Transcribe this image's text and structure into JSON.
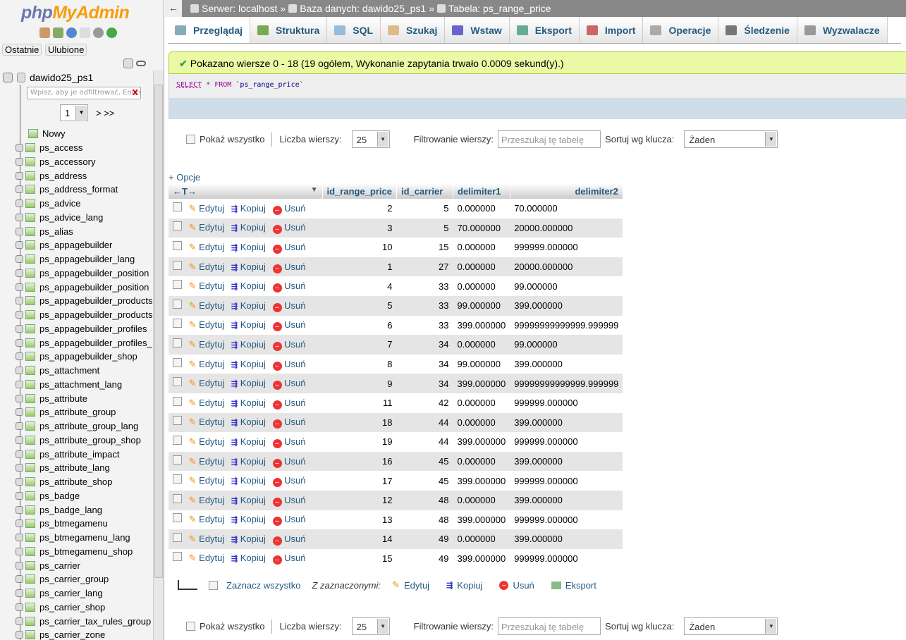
{
  "sidebar": {
    "logo_php": "php",
    "logo_my": "MyAdmin",
    "recent": "Ostatnie",
    "favorites": "Ulubione",
    "database": "dawido25_ps1",
    "filter_placeholder": "Wpisz, aby je odfiltrować, Enter, a",
    "filter_clear": "X",
    "page": "1",
    "page_next": "> >>",
    "new_label": "Nowy",
    "tables": [
      "ps_access",
      "ps_accessory",
      "ps_address",
      "ps_address_format",
      "ps_advice",
      "ps_advice_lang",
      "ps_alias",
      "ps_appagebuilder",
      "ps_appagebuilder_lang",
      "ps_appagebuilder_position",
      "ps_appagebuilder_position",
      "ps_appagebuilder_products",
      "ps_appagebuilder_products",
      "ps_appagebuilder_profiles",
      "ps_appagebuilder_profiles_",
      "ps_appagebuilder_shop",
      "ps_attachment",
      "ps_attachment_lang",
      "ps_attribute",
      "ps_attribute_group",
      "ps_attribute_group_lang",
      "ps_attribute_group_shop",
      "ps_attribute_impact",
      "ps_attribute_lang",
      "ps_attribute_shop",
      "ps_badge",
      "ps_badge_lang",
      "ps_btmegamenu",
      "ps_btmegamenu_lang",
      "ps_btmegamenu_shop",
      "ps_carrier",
      "ps_carrier_group",
      "ps_carrier_lang",
      "ps_carrier_shop",
      "ps_carrier_tax_rules_group",
      "ps_carrier_zone"
    ]
  },
  "breadcrumb": {
    "back": "←",
    "server": "Serwer: localhost",
    "sep": "»",
    "database": "Baza danych: dawido25_ps1",
    "table": "Tabela: ps_range_price"
  },
  "tabs": [
    "Przeglądaj",
    "Struktura",
    "SQL",
    "Szukaj",
    "Wstaw",
    "Eksport",
    "Import",
    "Operacje",
    "Śledzenie",
    "Wyzwalacze"
  ],
  "message": "Pokazano wiersze 0 - 18 (19 ogółem, Wykonanie zapytania trwało 0.0009 sekund(y).)",
  "sql": {
    "select": "SELECT",
    "star": " * ",
    "from": "FROM",
    "table": " `ps_range_price`"
  },
  "nav": {
    "show_all": "Pokaż wszystko",
    "rows_label": "Liczba wierszy:",
    "rows_value": "25",
    "filter_label": "Filtrowanie wierszy:",
    "filter_placeholder": "Przeszukaj tę tabelę",
    "sort_label": "Sortuj wg klucza:",
    "sort_value": "Żaden"
  },
  "options": "+ Opcje",
  "table": {
    "columns": [
      "id_range_price",
      "id_carrier",
      "delimiter1",
      "delimiter2"
    ],
    "edit": "Edytuj",
    "copy": "Kopiuj",
    "delete": "Usuń",
    "rows": [
      [
        "2",
        "5",
        "0.000000",
        "70.000000"
      ],
      [
        "3",
        "5",
        "70.000000",
        "20000.000000"
      ],
      [
        "10",
        "15",
        "0.000000",
        "999999.000000"
      ],
      [
        "1",
        "27",
        "0.000000",
        "20000.000000"
      ],
      [
        "4",
        "33",
        "0.000000",
        "99.000000"
      ],
      [
        "5",
        "33",
        "99.000000",
        "399.000000"
      ],
      [
        "6",
        "33",
        "399.000000",
        "99999999999999.999999"
      ],
      [
        "7",
        "34",
        "0.000000",
        "99.000000"
      ],
      [
        "8",
        "34",
        "99.000000",
        "399.000000"
      ],
      [
        "9",
        "34",
        "399.000000",
        "99999999999999.999999"
      ],
      [
        "11",
        "42",
        "0.000000",
        "999999.000000"
      ],
      [
        "18",
        "44",
        "0.000000",
        "399.000000"
      ],
      [
        "19",
        "44",
        "399.000000",
        "999999.000000"
      ],
      [
        "16",
        "45",
        "0.000000",
        "399.000000"
      ],
      [
        "17",
        "45",
        "399.000000",
        "999999.000000"
      ],
      [
        "12",
        "48",
        "0.000000",
        "399.000000"
      ],
      [
        "13",
        "48",
        "399.000000",
        "999999.000000"
      ],
      [
        "14",
        "49",
        "0.000000",
        "399.000000"
      ],
      [
        "15",
        "49",
        "399.000000",
        "999999.000000"
      ]
    ]
  },
  "bulk": {
    "select_all": "Zaznacz wszystko",
    "with_selected": "Z zaznaczonymi:",
    "edit": "Edytuj",
    "copy": "Kopiuj",
    "delete": "Usuń",
    "export": "Eksport"
  }
}
